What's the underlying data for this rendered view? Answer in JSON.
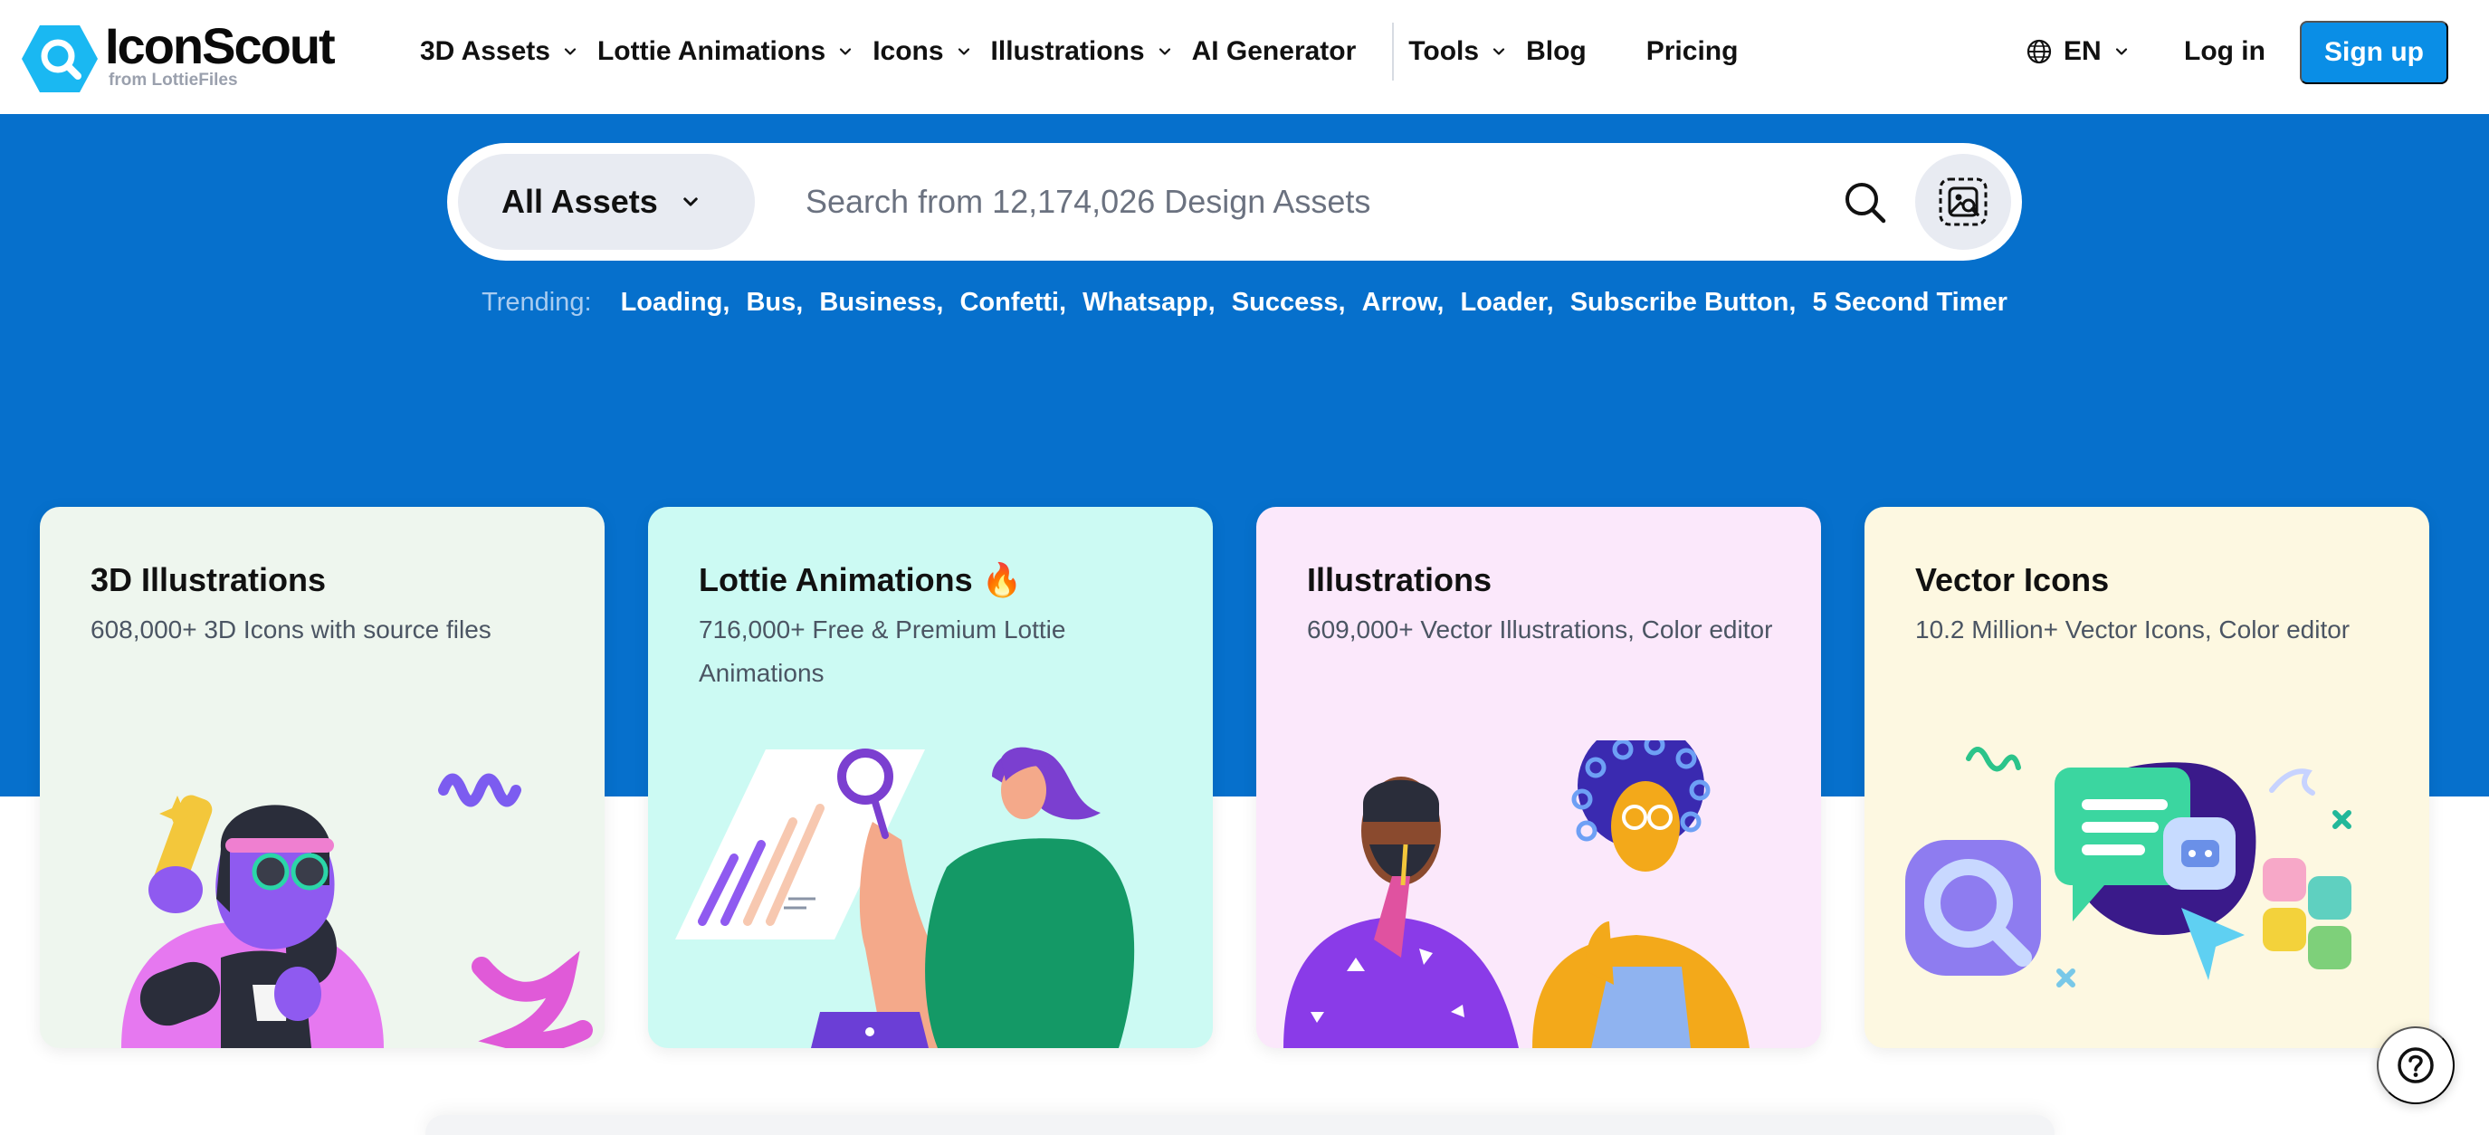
{
  "header": {
    "logo_name": "IconScout",
    "logo_sub": "from LottieFiles",
    "nav": [
      {
        "label": "3D Assets",
        "dropdown": true
      },
      {
        "label": "Lottie Animations",
        "dropdown": true
      },
      {
        "label": "Icons",
        "dropdown": true
      },
      {
        "label": "Illustrations",
        "dropdown": true
      },
      {
        "label": "AI Generator",
        "dropdown": false
      },
      {
        "label": "Tools",
        "dropdown": true
      },
      {
        "label": "Blog",
        "dropdown": false
      },
      {
        "label": "Pricing",
        "dropdown": false
      }
    ],
    "language": "EN",
    "login_label": "Log in",
    "signup_label": "Sign up"
  },
  "search": {
    "category": "All Assets",
    "placeholder": "Search from 12,174,026 Design Assets",
    "value": ""
  },
  "trending": {
    "label": "Trending:",
    "items": [
      "Loading",
      "Bus",
      "Business",
      "Confetti",
      "Whatsapp",
      "Success",
      "Arrow",
      "Loader",
      "Subscribe Button",
      "5 Second Timer"
    ]
  },
  "cards": [
    {
      "title": "3D Illustrations",
      "desc": "608,000+ 3D Icons with source files",
      "bg": "#eef6ee"
    },
    {
      "title": "Lottie Animations 🔥",
      "desc": "716,000+ Free & Premium Lottie Animations",
      "bg": "#ccfaf3"
    },
    {
      "title": "Illustrations",
      "desc": "609,000+ Vector Illustrations, Color editor",
      "bg": "#fbe8fb"
    },
    {
      "title": "Vector Icons",
      "desc": "10.2 Million+ Vector Icons, Color editor",
      "bg": "#fdf8e1"
    }
  ],
  "colors": {
    "brand_blue": "#0670cc",
    "signup_blue": "#0a8ee6",
    "logo_cyan": "#1ab8f2"
  }
}
